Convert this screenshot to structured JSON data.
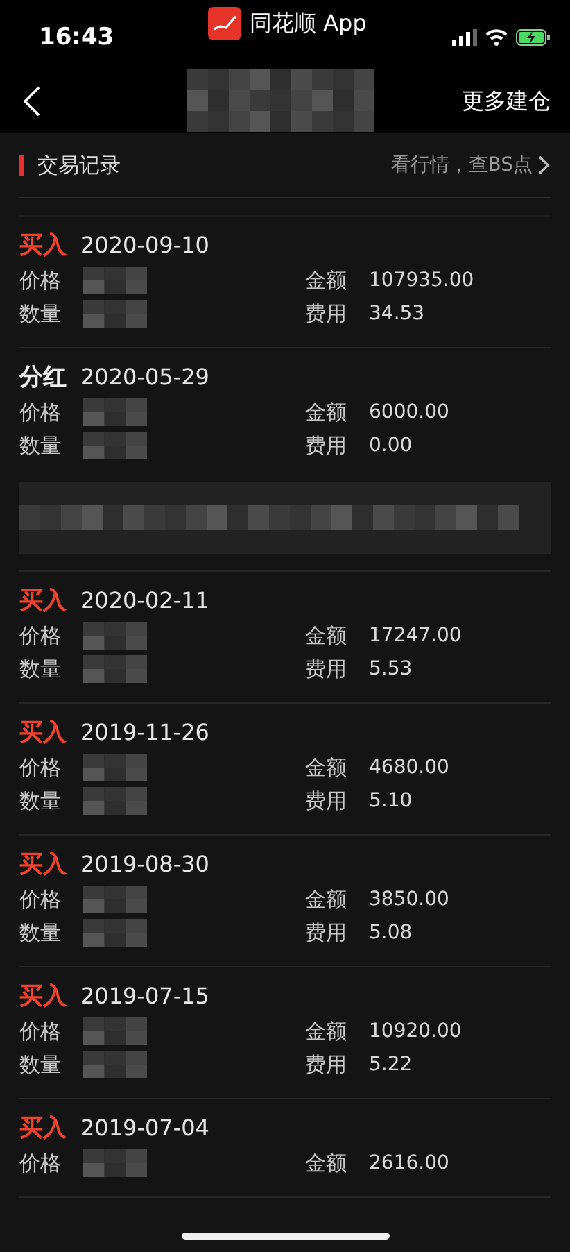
{
  "status_bar": {
    "time": "16:43",
    "app_name": "同花顺 App"
  },
  "nav": {
    "action": "更多建仓"
  },
  "section": {
    "title": "交易记录",
    "link": "看行情，查BS点"
  },
  "records": [
    {
      "kind": "buy",
      "type": "买入",
      "date": "2020-09-10",
      "rows": [
        {
          "label": "价格",
          "right_label": "金额",
          "right_value": "107935.00"
        },
        {
          "label": "数量",
          "right_label": "费用",
          "right_value": "34.53"
        }
      ]
    },
    {
      "kind": "dividend",
      "type": "分红",
      "date": "2020-05-29",
      "has_note": true,
      "rows": [
        {
          "label": "价格",
          "right_label": "金额",
          "right_value": "6000.00"
        },
        {
          "label": "数量",
          "right_label": "费用",
          "right_value": "0.00"
        }
      ]
    },
    {
      "kind": "buy",
      "type": "买入",
      "date": "2020-02-11",
      "rows": [
        {
          "label": "价格",
          "right_label": "金额",
          "right_value": "17247.00"
        },
        {
          "label": "数量",
          "right_label": "费用",
          "right_value": "5.53"
        }
      ]
    },
    {
      "kind": "buy",
      "type": "买入",
      "date": "2019-11-26",
      "rows": [
        {
          "label": "价格",
          "right_label": "金额",
          "right_value": "4680.00"
        },
        {
          "label": "数量",
          "right_label": "费用",
          "right_value": "5.10"
        }
      ]
    },
    {
      "kind": "buy",
      "type": "买入",
      "date": "2019-08-30",
      "rows": [
        {
          "label": "价格",
          "right_label": "金额",
          "right_value": "3850.00"
        },
        {
          "label": "数量",
          "right_label": "费用",
          "right_value": "5.08"
        }
      ]
    },
    {
      "kind": "buy",
      "type": "买入",
      "date": "2019-07-15",
      "rows": [
        {
          "label": "价格",
          "right_label": "金额",
          "right_value": "10920.00"
        },
        {
          "label": "数量",
          "right_label": "费用",
          "right_value": "5.22"
        }
      ]
    },
    {
      "kind": "buy",
      "type": "买入",
      "date": "2019-07-04",
      "rows": [
        {
          "label": "价格",
          "right_label": "金额",
          "right_value": "2616.00"
        }
      ]
    }
  ]
}
